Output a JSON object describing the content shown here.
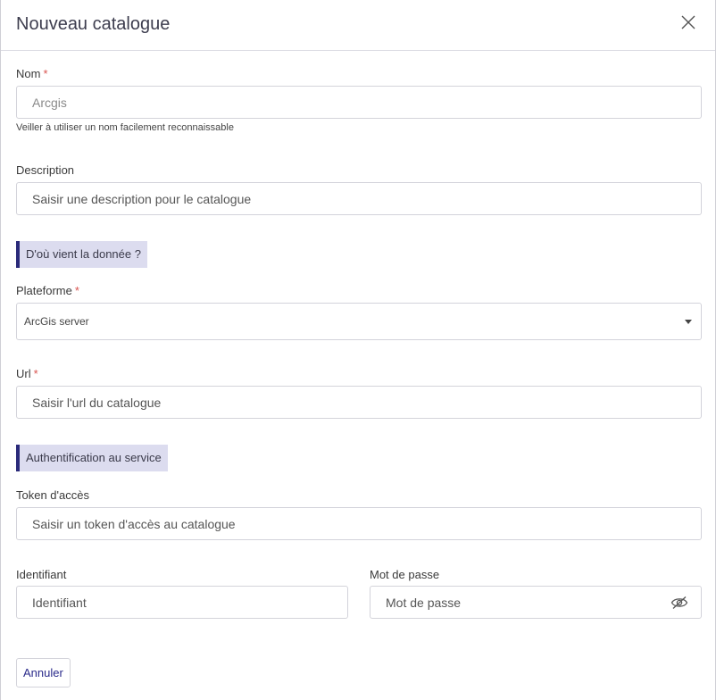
{
  "modal": {
    "title": "Nouveau catalogue"
  },
  "form": {
    "name": {
      "label": "Nom",
      "required_mark": "*",
      "value": "Arcgis",
      "hint": "Veiller à utiliser un nom facilement reconnaissable"
    },
    "description": {
      "label": "Description",
      "placeholder": "Saisir une description pour le catalogue"
    },
    "section_source": "D'où vient la donnée ?",
    "platform": {
      "label": "Plateforme",
      "required_mark": "*",
      "selected": "ArcGis server"
    },
    "url": {
      "label": "Url",
      "required_mark": "*",
      "placeholder": "Saisir l'url du catalogue"
    },
    "section_auth": "Authentification au service",
    "token": {
      "label": "Token d'accès",
      "placeholder": "Saisir un token d'accès au catalogue"
    },
    "login": {
      "label": "Identifiant",
      "placeholder": "Identifiant"
    },
    "password": {
      "label": "Mot de passe",
      "placeholder": "Mot de passe"
    }
  },
  "actions": {
    "cancel_label": "Annuler"
  }
}
